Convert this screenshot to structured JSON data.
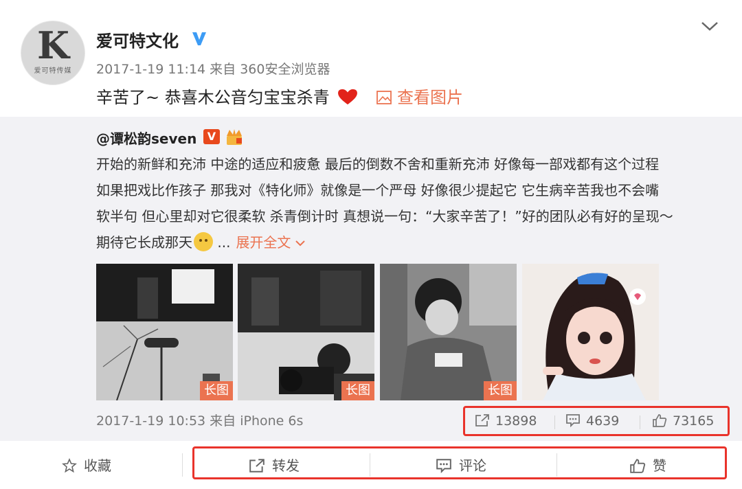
{
  "post": {
    "author": "爱可特文化",
    "avatar_char": "K",
    "avatar_sub": "爱可特传媒",
    "meta": "2017-1-19 11:14 来自 360安全浏览器",
    "content": "辛苦了~ 恭喜木公音匀宝宝杀青",
    "view_pic_label": "查看图片"
  },
  "repost": {
    "user": "@谭松韵seven",
    "v_badge": "V",
    "lines": [
      "开始的新鲜和充沛 中途的适应和疲惫 最后的倒数不舍和重新充沛 好像每一部戏都有这个过程",
      "如果把戏比作孩子 那我对《特化师》就像是一个严母 好像很少提起它 它生病辛苦我也不会嘴",
      "软半句 但心里却对它很柔软 杀青倒计时 真想说一句：“大家辛苦了！”好的团队必有好的呈现～",
      "期待它长成那天"
    ],
    "ellipsis": "...",
    "expand_label": "展开全文",
    "long_image_label": "长图",
    "meta": "2017-1-19 10:53 来自 iPhone 6s",
    "stats": {
      "repost": "13898",
      "comment": "4639",
      "like": "73165"
    }
  },
  "bar": {
    "favorite": "收藏",
    "repost": "转发",
    "comment": "评论",
    "like": "赞"
  },
  "colors": {
    "accent": "#eb7350",
    "highlight": "#e9332b",
    "verified": "#3d9cf5"
  }
}
